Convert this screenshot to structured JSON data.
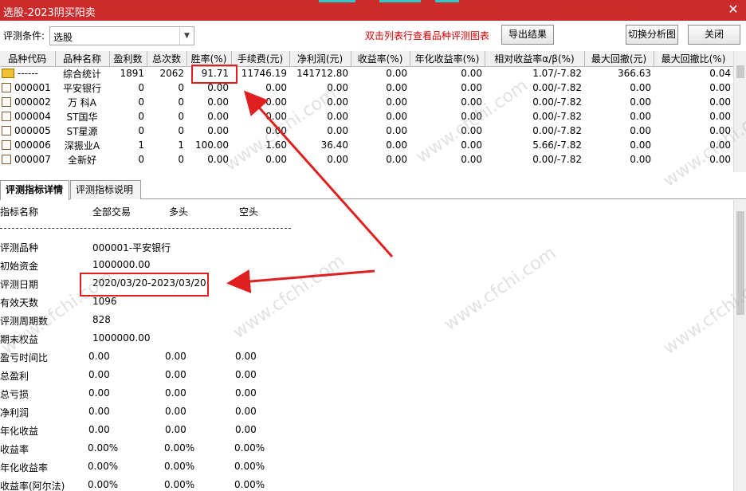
{
  "window": {
    "title": "选股-2023阴买阳卖",
    "close_label": "✕"
  },
  "toolbar": {
    "condition_label": "评测条件:",
    "condition_value": "选股",
    "hint": "双击列表行查看品种评测图表",
    "export_label": "导出结果",
    "switch_label": "切换分析图",
    "close_label": "关闭"
  },
  "grid": {
    "columns": [
      "品种代码",
      "品种名称",
      "盈利数",
      "总次数",
      "胜率(%)",
      "手续费(元)",
      "净利润(元)",
      "收益率(%)",
      "年化收益率(%)",
      "相对收益率α/β(%)",
      "最大回撤(元)",
      "最大回撤比(%)"
    ],
    "rows": [
      [
        "------",
        "综合统计",
        "1891",
        "2062",
        "91.71",
        "11746.19",
        "141712.80",
        "0.00",
        "0.00",
        "1.07/-7.82",
        "366.63",
        "0.04"
      ],
      [
        "000001",
        "平安银行",
        "0",
        "0",
        "0.00",
        "0.00",
        "0.00",
        "0.00",
        "0.00",
        "0.00/-7.82",
        "0.00",
        "0.00"
      ],
      [
        "000002",
        "万 科A",
        "0",
        "0",
        "0.00",
        "0.00",
        "0.00",
        "0.00",
        "0.00",
        "0.00/-7.82",
        "0.00",
        "0.00"
      ],
      [
        "000004",
        "ST国华",
        "0",
        "0",
        "0.00",
        "0.00",
        "0.00",
        "0.00",
        "0.00",
        "0.00/-7.82",
        "0.00",
        "0.00"
      ],
      [
        "000005",
        "ST星源",
        "0",
        "0",
        "0.00",
        "0.00",
        "0.00",
        "0.00",
        "0.00",
        "0.00/-7.82",
        "0.00",
        "0.00"
      ],
      [
        "000006",
        "深振业A",
        "1",
        "1",
        "100.00",
        "1.60",
        "36.40",
        "0.00",
        "0.00",
        "5.66/-7.82",
        "0.00",
        "0.00"
      ],
      [
        "000007",
        "全新好",
        "0",
        "0",
        "0.00",
        "0.00",
        "0.00",
        "0.00",
        "0.00",
        "0.00/-7.82",
        "0.00",
        "0.00"
      ]
    ]
  },
  "tabs": [
    "评测指标详情",
    "评测指标说明"
  ],
  "detail": {
    "header": [
      "指标名称",
      "全部交易",
      "多头",
      "空头"
    ],
    "separator": "-------------------------------------------------------",
    "rows": [
      {
        "label": "评测品种",
        "values": [
          "000001-平安银行"
        ]
      },
      {
        "label": "初始资金",
        "values": [
          "1000000.00"
        ]
      },
      {
        "label": "评测日期",
        "values": [
          "2020/03/20-2023/03/20"
        ]
      },
      {
        "label": "有效天数",
        "values": [
          "1096"
        ]
      },
      {
        "label": "评测周期数",
        "values": [
          "828"
        ]
      },
      {
        "label": "期末权益",
        "values": [
          "1000000.00"
        ]
      },
      {
        "label": "盈亏时间比",
        "values": [
          "0.00",
          "0.00",
          "0.00"
        ]
      },
      {
        "label": "总盈利",
        "values": [
          "0.00",
          "0.00",
          "0.00"
        ]
      },
      {
        "label": "总亏损",
        "values": [
          "0.00",
          "0.00",
          "0.00"
        ]
      },
      {
        "label": "净利润",
        "values": [
          "0.00",
          "0.00",
          "0.00"
        ]
      },
      {
        "label": "年化收益",
        "values": [
          "0.00",
          "0.00",
          "0.00"
        ]
      },
      {
        "label": "收益率",
        "values": [
          "0.00%",
          "0.00%",
          "0.00%"
        ]
      },
      {
        "label": "年化收益率",
        "values": [
          "0.00%",
          "0.00%",
          "0.00%"
        ]
      },
      {
        "label": "收益率(阿尔法)",
        "values": [
          "0.00%",
          "0.00%",
          "0.00%"
        ]
      }
    ]
  },
  "watermark": "www.cfchi.com",
  "colors": {
    "title_bar": "#cc2b2b",
    "hint": "#d40000",
    "annotation": "#e02020"
  }
}
